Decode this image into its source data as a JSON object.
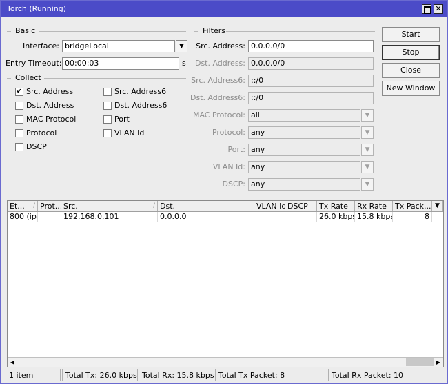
{
  "window": {
    "title": "Torch (Running)"
  },
  "basic": {
    "title": "Basic",
    "interface_label": "Interface:",
    "interface_value": "bridgeLocal",
    "timeout_label": "Entry Timeout:",
    "timeout_value": "00:00:03",
    "timeout_unit": "s"
  },
  "collect": {
    "title": "Collect",
    "items": [
      {
        "label": "Src. Address",
        "checked": true
      },
      {
        "label": "Src. Address6",
        "checked": false
      },
      {
        "label": "Dst. Address",
        "checked": false
      },
      {
        "label": "Dst. Address6",
        "checked": false
      },
      {
        "label": "MAC Protocol",
        "checked": false
      },
      {
        "label": "Port",
        "checked": false
      },
      {
        "label": "Protocol",
        "checked": false
      },
      {
        "label": "VLAN Id",
        "checked": false
      },
      {
        "label": "DSCP",
        "checked": false
      }
    ],
    "check_mark": "✔"
  },
  "filters": {
    "title": "Filters",
    "src_address_label": "Src. Address:",
    "src_address_value": "0.0.0.0/0",
    "dst_address_label": "Dst. Address:",
    "dst_address_value": "0.0.0.0/0",
    "src_address6_label": "Src. Address6:",
    "src_address6_value": "::/0",
    "dst_address6_label": "Dst. Address6:",
    "dst_address6_value": "::/0",
    "mac_protocol_label": "MAC Protocol:",
    "mac_protocol_value": "all",
    "protocol_label": "Protocol:",
    "protocol_value": "any",
    "port_label": "Port:",
    "port_value": "any",
    "vlan_label": "VLAN Id:",
    "vlan_value": "any",
    "dscp_label": "DSCP:",
    "dscp_value": "any"
  },
  "buttons": {
    "start": "Start",
    "stop": "Stop",
    "close": "Close",
    "new_window": "New Window"
  },
  "table": {
    "columns": [
      "Et...",
      "Prot...",
      "Src.",
      "Dst.",
      "VLAN Id",
      "DSCP",
      "Tx Rate",
      "Rx Rate",
      "Tx Pack..."
    ],
    "rows": [
      [
        "800 (ip)",
        "",
        "192.168.0.101",
        "0.0.0.0",
        "",
        "",
        "26.0 kbps",
        "15.8 kbps",
        "8"
      ]
    ]
  },
  "status": {
    "items": "1 item",
    "total_tx": "Total Tx: 26.0 kbps",
    "total_rx": "Total Rx: 15.8 kbps",
    "total_tx_packet": "Total Tx Packet: 8",
    "total_rx_packet": "Total Rx Packet: 10"
  }
}
